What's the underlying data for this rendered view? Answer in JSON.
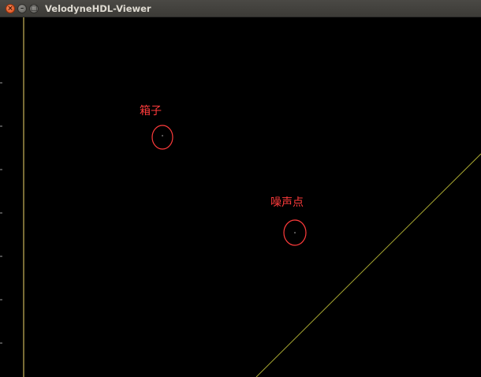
{
  "window": {
    "title": "VelodyneHDL-Viewer",
    "buttons": {
      "close": "×",
      "minimize": "–",
      "maximize": "□"
    }
  },
  "viewport": {
    "background": "#000000",
    "axis_color": "#c8b45a",
    "diagonal_line_color": "#a8a832",
    "annotation_color": "#ff3b3b"
  },
  "annotations": [
    {
      "label": "箱子"
    },
    {
      "label": "噪声点"
    }
  ]
}
